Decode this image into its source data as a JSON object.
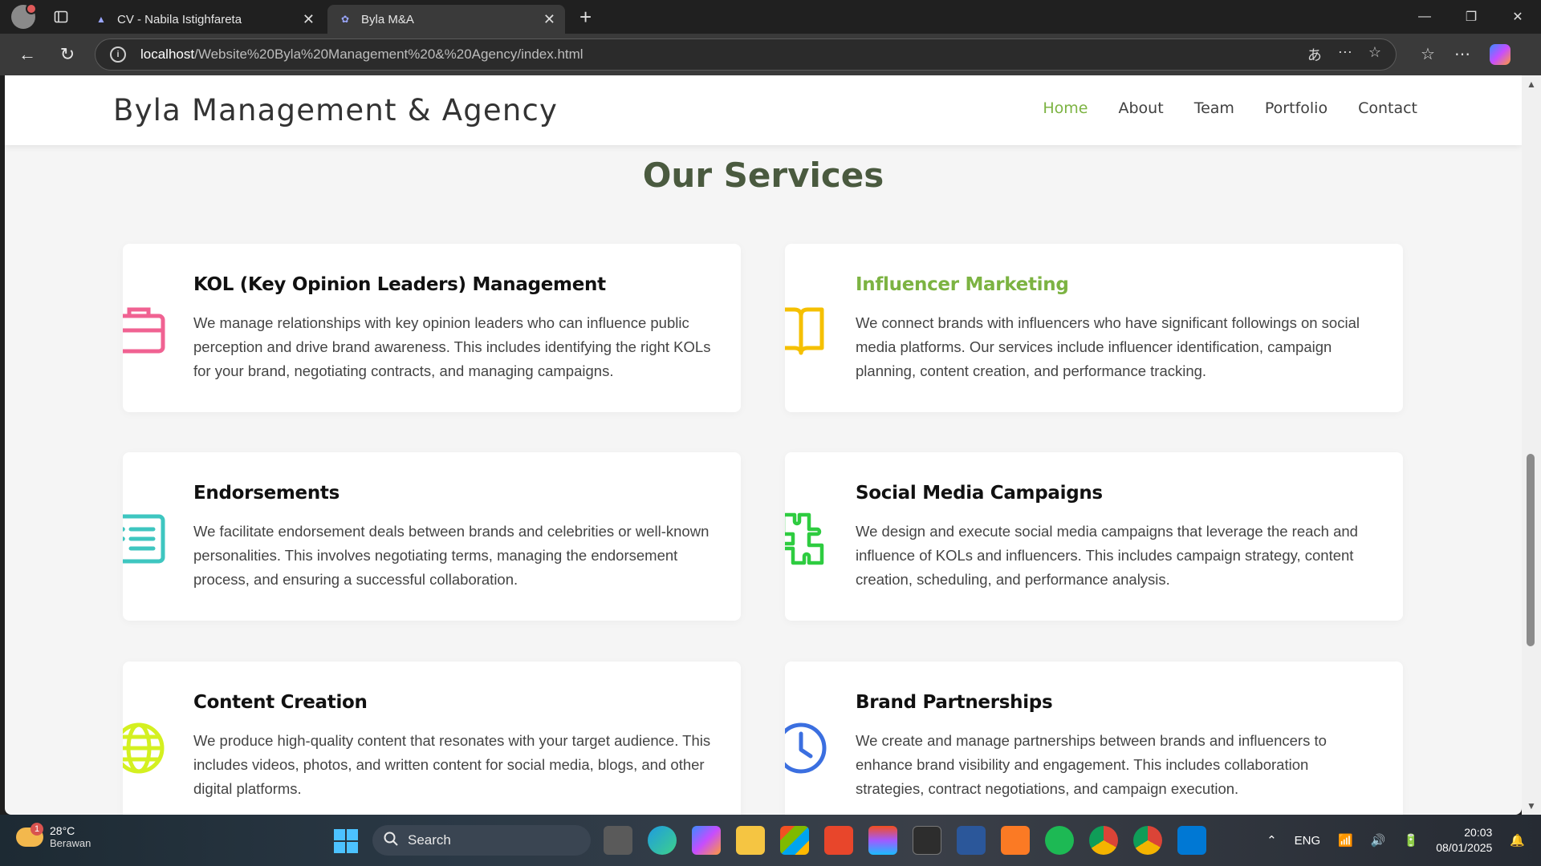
{
  "browser": {
    "tabs": [
      {
        "title": "CV - Nabila Istighfareta",
        "active": false
      },
      {
        "title": "Byla M&A",
        "active": true
      }
    ],
    "url_host": "localhost",
    "url_path": "/Website%20Byla%20Management%20&%20Agency/index.html"
  },
  "site": {
    "brand": "Byla Management & Agency",
    "nav": [
      "Home",
      "About",
      "Team",
      "Portfolio",
      "Contact"
    ],
    "active_nav": "Home",
    "accent_color": "#7cb342"
  },
  "services": {
    "title": "Our Services",
    "items": [
      {
        "title": "KOL (Key Opinion Leaders) Management",
        "icon": "briefcase-icon",
        "color": "#f06292",
        "desc": "We manage relationships with key opinion leaders who can influence public perception and drive brand awareness. This includes identifying the right KOLs for your brand, negotiating contracts, and managing campaigns."
      },
      {
        "title": "Influencer Marketing",
        "icon": "book-icon",
        "color": "#f5c000",
        "desc": "We connect brands with influencers who have significant followings on social media platforms. Our services include influencer identification, campaign planning, content creation, and performance tracking."
      },
      {
        "title": "Endorsements",
        "icon": "list-icon",
        "color": "#3ec6c0",
        "desc": "We facilitate endorsement deals between brands and celebrities or well-known personalities. This involves negotiating terms, managing the endorsement process, and ensuring a successful collaboration."
      },
      {
        "title": "Social Media Campaigns",
        "icon": "puzzle-icon",
        "color": "#2ecc40",
        "desc": "We design and execute social media campaigns that leverage the reach and influence of KOLs and influencers. This includes campaign strategy, content creation, scheduling, and performance analysis."
      },
      {
        "title": "Content Creation",
        "icon": "globe-icon",
        "color": "#d4f020",
        "desc": "We produce high-quality content that resonates with your target audience. This includes videos, photos, and written content for social media, blogs, and other digital platforms."
      },
      {
        "title": "Brand Partnerships",
        "icon": "clock-icon",
        "color": "#3b6fe0",
        "desc": "We create and manage partnerships between brands and influencers to enhance brand visibility and engagement. This includes collaboration strategies, contract negotiations, and campaign execution."
      }
    ]
  },
  "taskbar": {
    "weather_temp": "28°C",
    "weather_desc": "Berawan",
    "weather_badge": "1",
    "search_label": "Search",
    "language": "ENG",
    "time": "20:03",
    "date": "08/01/2025"
  }
}
